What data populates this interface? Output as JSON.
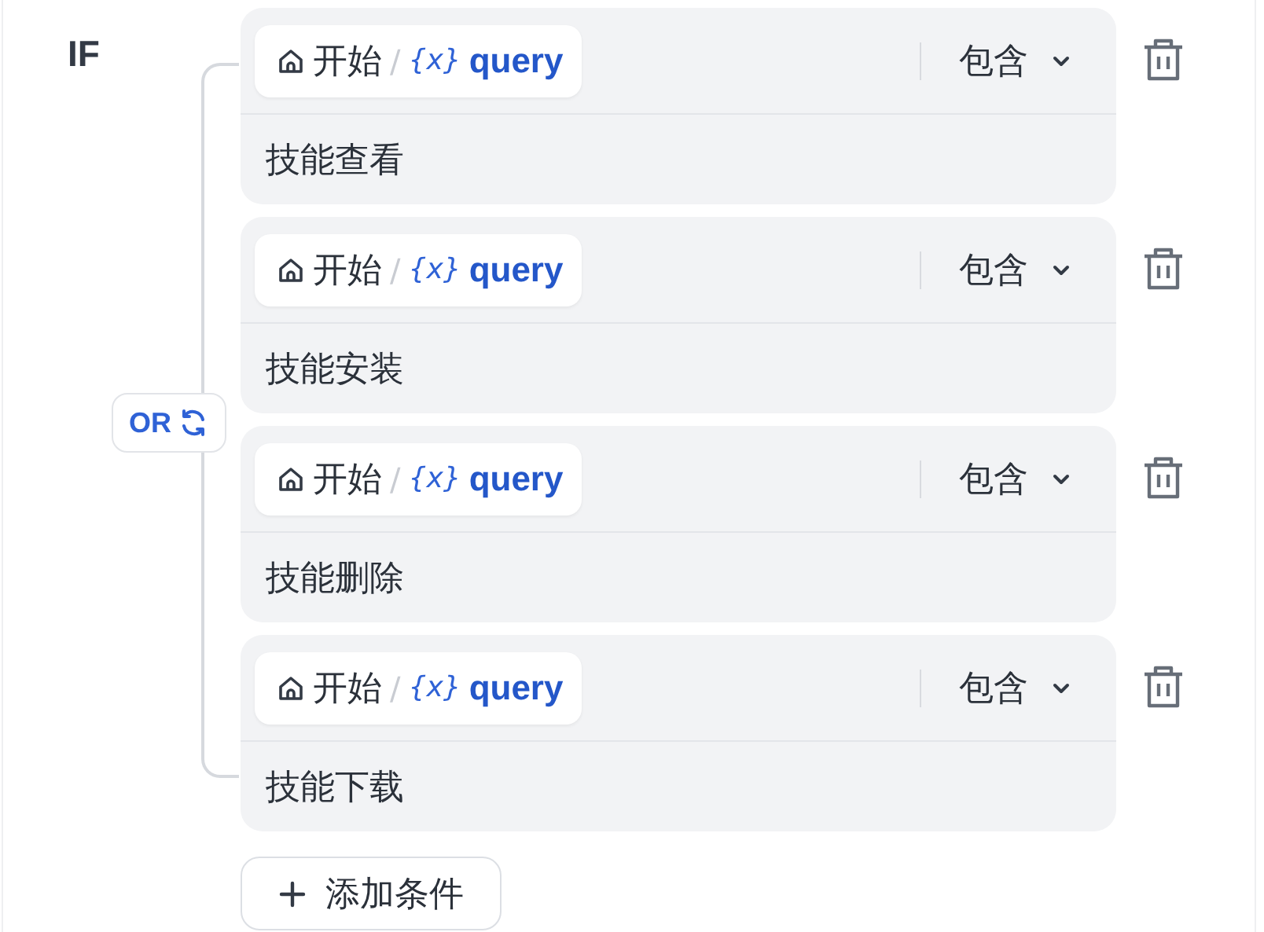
{
  "label": "IF",
  "logic": {
    "label": "OR"
  },
  "conditions": [
    {
      "source": "开始",
      "separator": "/",
      "variable_icon": "{x}",
      "variable": "query",
      "operator": "包含",
      "value": "技能查看"
    },
    {
      "source": "开始",
      "separator": "/",
      "variable_icon": "{x}",
      "variable": "query",
      "operator": "包含",
      "value": "技能安装"
    },
    {
      "source": "开始",
      "separator": "/",
      "variable_icon": "{x}",
      "variable": "query",
      "operator": "包含",
      "value": "技能删除"
    },
    {
      "source": "开始",
      "separator": "/",
      "variable_icon": "{x}",
      "variable": "query",
      "operator": "包含",
      "value": "技能下载"
    }
  ],
  "add_button": {
    "label": "添加条件"
  }
}
